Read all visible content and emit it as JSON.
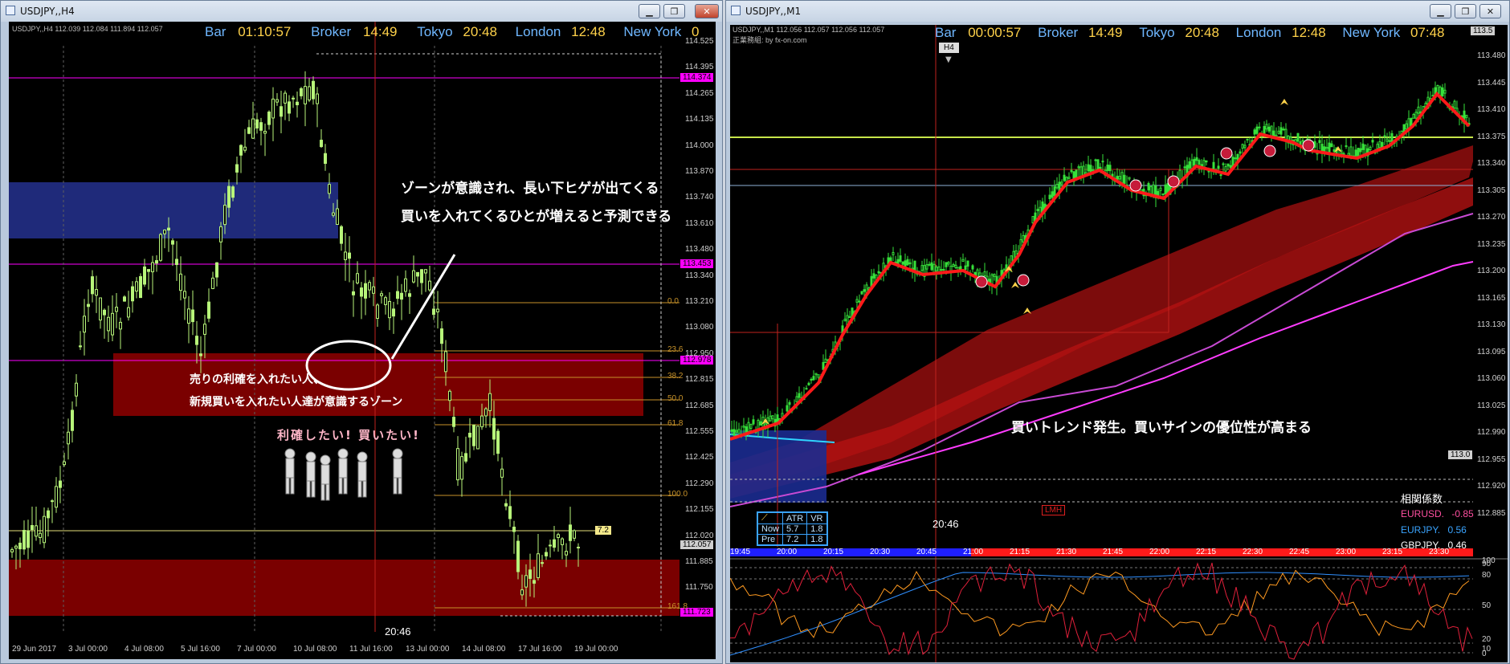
{
  "windows": [
    {
      "title": "USDJPY,,H4",
      "chart_label": "USDJPY,,H4  112.039 112.084 111.894 112.057",
      "session_bar": {
        "bar_label": "Bar",
        "bar_value": "01:10:57",
        "broker_label": "Broker",
        "broker_value": "14:49",
        "tokyo_label": "Tokyo",
        "tokyo_value": "20:48",
        "london_label": "London",
        "london_value": "12:48",
        "newyork_label": "New York",
        "newyork_value": "0"
      },
      "price_axis": [
        "114.525",
        "114.395",
        "114.265",
        "114.135",
        "114.000",
        "113.870",
        "113.740",
        "113.610",
        "113.480",
        "113.340",
        "113.210",
        "113.080",
        "112.950",
        "112.815",
        "112.685",
        "112.555",
        "112.425",
        "112.290",
        "112.155",
        "112.020",
        "111.885",
        "111.750",
        "111.620"
      ],
      "price_tags": [
        {
          "label": "114.374",
          "color": "#ff00ff"
        },
        {
          "label": "113.453",
          "color": "#ff00ff"
        },
        {
          "label": "112.978",
          "color": "#ff00ff"
        },
        {
          "label": "112.057",
          "color": "#cfcfcf"
        },
        {
          "label": "111.723",
          "color": "#ff00ff"
        }
      ],
      "fib_levels": [
        "0.0",
        "23.6",
        "38.2",
        "50.0",
        "61.8",
        "100.0",
        "161.8"
      ],
      "time_axis": [
        "29 Jun 2017",
        "3 Jul 00:00",
        "4 Jul 08:00",
        "5 Jul 16:00",
        "7 Jul 00:00",
        "10 Jul 08:00",
        "11 Jul 16:00",
        "13 Jul 00:00",
        "14 Jul 08:00",
        "17 Jul 16:00",
        "19 Jul 00:00"
      ],
      "crosshair_time": "20:46",
      "value_box": "7.2",
      "annotation_top_1": "ゾーンが意識され、長い下ヒゲが出てくる",
      "annotation_top_2": "買いを入れてくるひとが増えると予測できる",
      "zone_text_1": "売りの利確を入れたい人、",
      "zone_text_2": "新規買いを入れたい人達が意識するゾーン",
      "people_caption": "利確したい! 買いたい!"
    },
    {
      "title": "USDJPY,,M1",
      "chart_label": "USDJPY,,M1  112.056 112.057 112.056 112.057",
      "sub_label": "正業務組: by fx-on.com",
      "tf_button": "H4",
      "session_bar": {
        "bar_label": "Bar",
        "bar_value": "00:00:57",
        "broker_label": "Broker",
        "broker_value": "14:49",
        "tokyo_label": "Tokyo",
        "tokyo_value": "20:48",
        "london_label": "London",
        "london_value": "12:48",
        "newyork_label": "New York",
        "newyork_value": "07:48"
      },
      "price_axis": [
        "113.480",
        "113.445",
        "113.410",
        "113.375",
        "113.340",
        "113.305",
        "113.270",
        "113.235",
        "113.200",
        "113.165",
        "113.130",
        "113.095",
        "113.060",
        "113.025",
        "112.990",
        "112.955",
        "112.920",
        "112.885"
      ],
      "price_tags": [
        {
          "label": "113.5"
        },
        {
          "label": "113.0"
        }
      ],
      "time_axis": [
        "19:45",
        "20:00",
        "20:15",
        "20:30",
        "20:45",
        "21:00",
        "21:15",
        "21:30",
        "21:45",
        "22:00",
        "22:15",
        "22:30",
        "22:45",
        "23:00",
        "23:15",
        "23:30"
      ],
      "crosshair_time": "20:46",
      "annotation": "買いトレンド発生。買いサインの優位性が高まる",
      "lmh_tag": "LMH",
      "stats": {
        "header": [
          "",
          "ATR",
          "VR"
        ],
        "rows": [
          [
            "Now",
            "5.7",
            "1.8"
          ],
          [
            "Pre",
            "7.2",
            "1.8"
          ]
        ]
      },
      "correlation": {
        "title": "相関係数",
        "rows": [
          {
            "pair": "EURUSD.",
            "value": "-0.85",
            "color": "#ff4fa0"
          },
          {
            "pair": "EURJPY.",
            "value": "0.56",
            "color": "#3aa4ff"
          },
          {
            "pair": "GBPJPY.",
            "value": "0.46",
            "color": "#ffffff"
          }
        ]
      },
      "osc_axis": [
        "100",
        "90",
        "80",
        "50",
        "20",
        "10",
        "0"
      ]
    }
  ]
}
